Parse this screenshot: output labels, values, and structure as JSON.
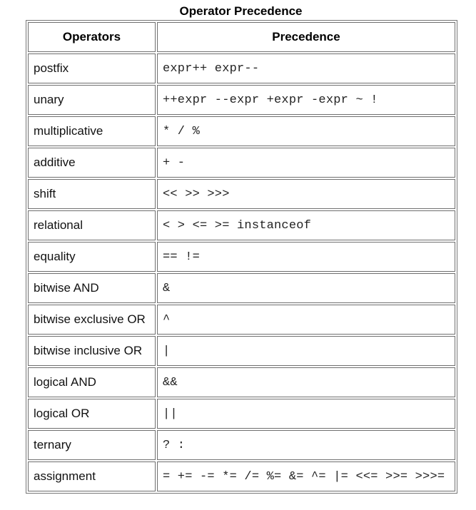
{
  "table": {
    "caption": "Operator Precedence",
    "headers": [
      "Operators",
      "Precedence"
    ],
    "rows": [
      {
        "operator": "postfix",
        "precedence": "expr++ expr--"
      },
      {
        "operator": "unary",
        "precedence": "++expr --expr +expr -expr ~ !"
      },
      {
        "operator": "multiplicative",
        "precedence": "* / %"
      },
      {
        "operator": "additive",
        "precedence": "+ -"
      },
      {
        "operator": "shift",
        "precedence": "<< >> >>>"
      },
      {
        "operator": "relational",
        "precedence": "< > <= >= instanceof"
      },
      {
        "operator": "equality",
        "precedence": "== !="
      },
      {
        "operator": "bitwise AND",
        "precedence": "&"
      },
      {
        "operator": "bitwise exclusive OR",
        "precedence": "^"
      },
      {
        "operator": "bitwise inclusive OR",
        "precedence": "|"
      },
      {
        "operator": "logical AND",
        "precedence": "&&"
      },
      {
        "operator": "logical OR",
        "precedence": "||"
      },
      {
        "operator": "ternary",
        "precedence": "? :"
      },
      {
        "operator": "assignment",
        "precedence": "= += -= *= /= %= &= ^= |= <<= >>= >>>="
      }
    ]
  }
}
